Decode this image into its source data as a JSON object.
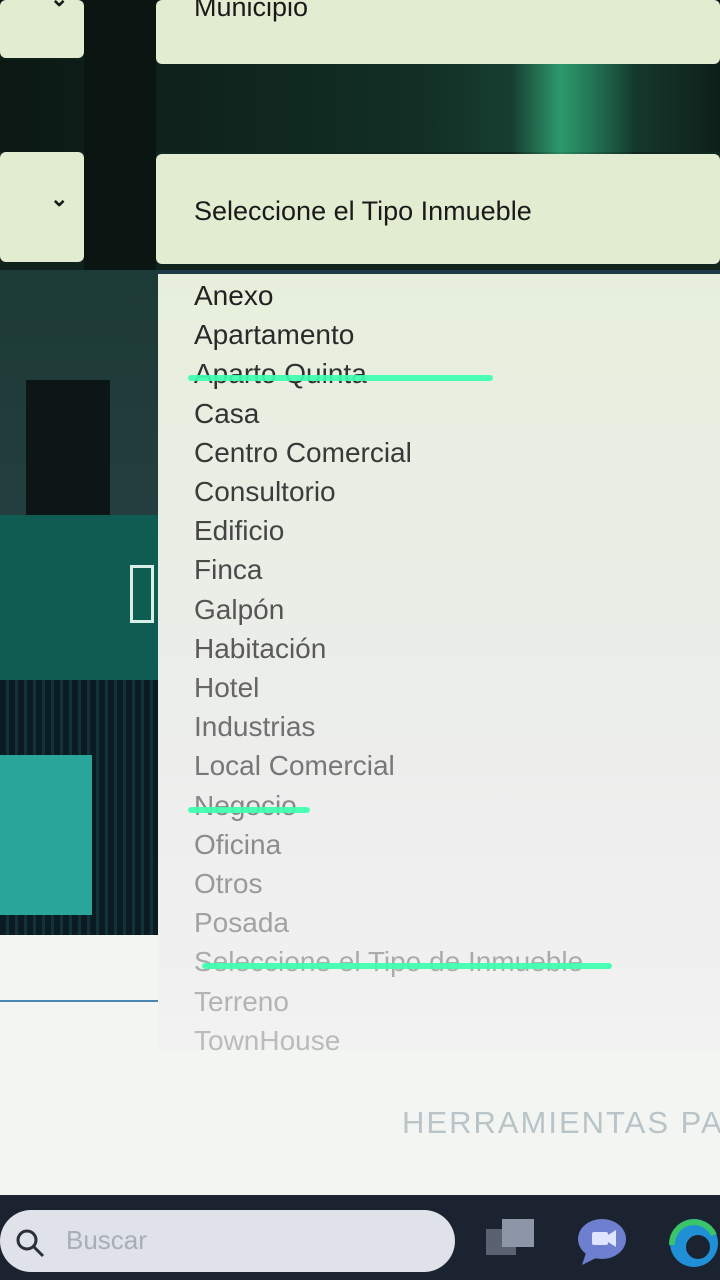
{
  "form": {
    "municipio_label": "Municipio",
    "tipo_inmueble_label": "Seleccione el Tipo Inmueble"
  },
  "dropdown": {
    "options": [
      {
        "label": "Anexo",
        "struck": false
      },
      {
        "label": "Apartamento",
        "struck": false
      },
      {
        "label": "Aparto Quinta",
        "struck": true
      },
      {
        "label": "Casa",
        "struck": false
      },
      {
        "label": "Centro Comercial",
        "struck": false
      },
      {
        "label": "Consultorio",
        "struck": false
      },
      {
        "label": "Edificio",
        "struck": false
      },
      {
        "label": "Finca",
        "struck": false
      },
      {
        "label": "Galpón",
        "struck": false
      },
      {
        "label": "Habitación",
        "struck": false
      },
      {
        "label": "Hotel",
        "struck": false
      },
      {
        "label": "Industrias",
        "struck": false
      },
      {
        "label": "Local Comercial",
        "struck": false
      },
      {
        "label": "Negocio",
        "struck": true
      },
      {
        "label": "Oficina",
        "struck": false
      },
      {
        "label": "Otros",
        "struck": false
      },
      {
        "label": "Posada",
        "struck": false
      },
      {
        "label": "Seleccione el Tipo de Inmueble",
        "struck": true
      },
      {
        "label": "Terreno",
        "struck": false
      },
      {
        "label": "TownHouse",
        "struck": false
      }
    ],
    "strike_color": "#3dffb0"
  },
  "banner": {
    "text": "HERRAMIENTAS PA"
  },
  "taskbar": {
    "search_placeholder": "Buscar",
    "icons": [
      "search-icon",
      "task-view-icon",
      "chat-icon",
      "edge-icon"
    ]
  },
  "colors": {
    "field_bg": "#e1ecd0",
    "taskbar_bg": "#1b2330",
    "dropdown_border": "#1e3a4a"
  }
}
